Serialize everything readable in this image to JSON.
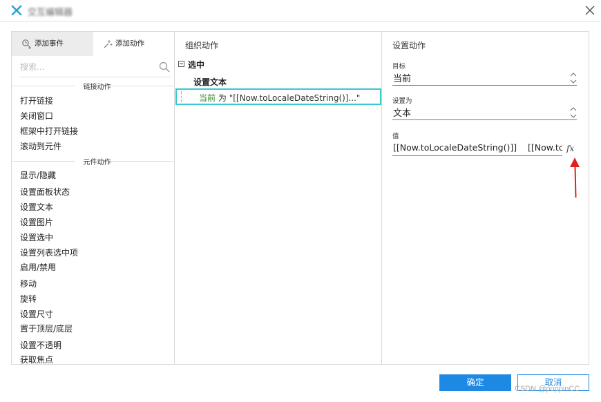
{
  "window": {
    "title": "交互编辑器",
    "logo_icon": "axure-x-logo",
    "close_icon": "close-icon"
  },
  "left_panel": {
    "tabs": [
      {
        "label": "添加事件",
        "icon": "add-event-icon",
        "active": true
      },
      {
        "label": "添加动作",
        "icon": "add-action-icon",
        "active": false
      }
    ],
    "search": {
      "placeholder": "搜索...",
      "value": "",
      "icon": "search-icon"
    },
    "sections": [
      {
        "title": "链接动作",
        "items": [
          "打开链接",
          "关闭窗口",
          "框架中打开链接",
          "滚动到元件"
        ]
      },
      {
        "title": "元件动作",
        "items": [
          "显示/隐藏",
          "设置面板状态",
          "设置文本",
          "设置图片",
          "设置选中",
          "设置列表选中项",
          "启用/禁用",
          "移动",
          "旋转",
          "设置尺寸",
          "置于顶层/底层",
          "设置不透明",
          "获取焦点"
        ]
      }
    ]
  },
  "middle_panel": {
    "title": "组织动作",
    "event": "选中",
    "case": "设置文本",
    "action": {
      "target": "当前",
      "connector": "为",
      "value": "\"[[Now.toLocaleDateString()]...\""
    }
  },
  "right_panel": {
    "title": "设置动作",
    "target": {
      "label": "目标",
      "value": "当前"
    },
    "set_to": {
      "label": "设置为",
      "value": "文本"
    },
    "value": {
      "label": "值",
      "value": "[[Now.toLocaleDateString()]]    [[Now.tc",
      "fx_label": "fx"
    }
  },
  "footer": {
    "ok_label": "确定",
    "cancel_label": "取消",
    "watermark": "CSDN @poppinCC"
  },
  "colors": {
    "primary": "#1e88e5",
    "selection_border": "#39c7d1",
    "target_text": "#2b8a1d",
    "annotation_arrow": "#e02020",
    "logo": "#2aa3d8"
  }
}
